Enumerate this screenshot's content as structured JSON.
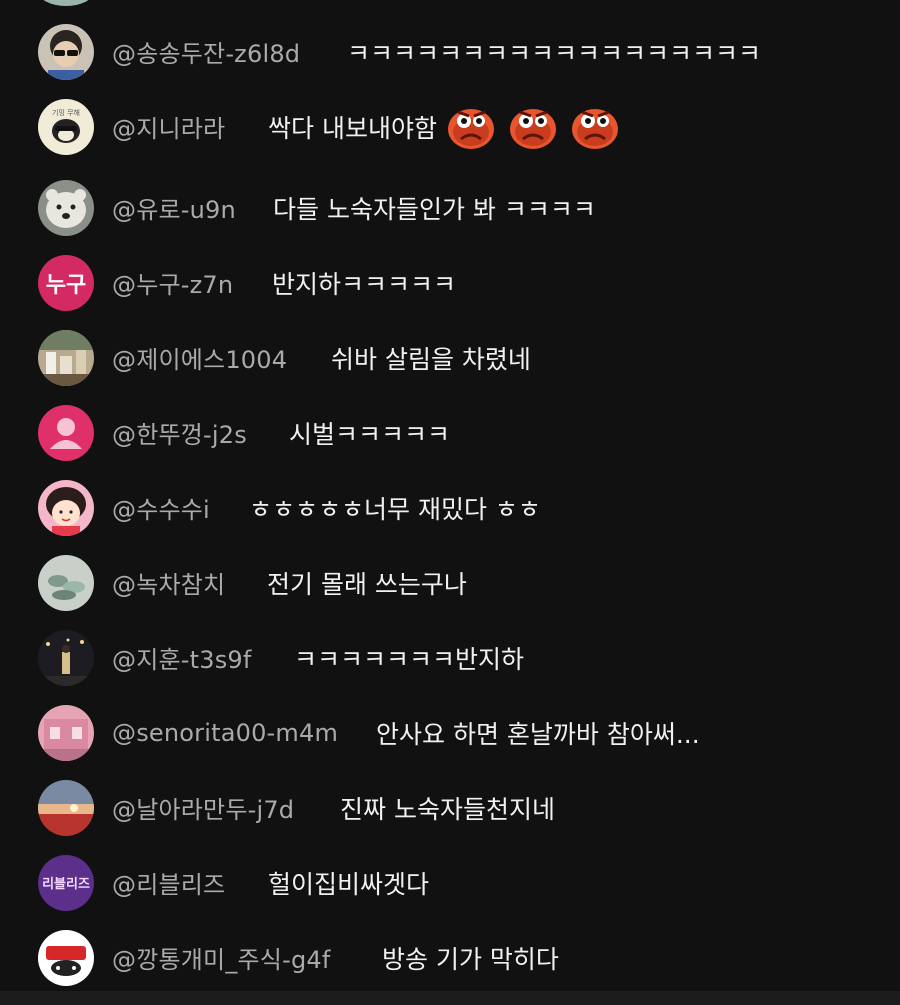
{
  "chat": {
    "messages": [
      {
        "author": "@송송두잔-z6l8d",
        "text": "ㅋㅋㅋㅋㅋㅋㅋㅋㅋㅋㅋㅋㅋㅋㅋㅋㅋㅋ",
        "avatar": "avatar-photo-person-sunglasses"
      },
      {
        "author": "@지니라라",
        "text": "싹다 내보내야함",
        "avatar": "avatar-illustration-bird",
        "emojis": [
          "angry-face-emoji",
          "angry-face-emoji",
          "angry-face-emoji"
        ]
      },
      {
        "author": "@유로-u9n",
        "text": "다들 노숙자들인가 봐 ㅋㅋㅋㅋ",
        "avatar": "avatar-photo-polar-bear"
      },
      {
        "author": "@누구-z7n",
        "text": "반지하ㅋㅋㅋㅋㅋ",
        "avatar": "avatar-text",
        "avatar_text": "누구"
      },
      {
        "author": "@제이에스1004",
        "text": "쉬바 살림을 차렸네",
        "avatar": "avatar-photo-cafe"
      },
      {
        "author": "@한뚜껑-j2s",
        "text": "시벌ㅋㅋㅋㅋㅋ",
        "avatar": "avatar-default-person"
      },
      {
        "author": "@수수수i",
        "text": "ㅎㅎㅎㅎㅎ너무 재밌다 ㅎㅎ",
        "avatar": "avatar-cartoon-girl"
      },
      {
        "author": "@녹차참치",
        "text": "전기 몰래 쓰는구나",
        "avatar": "avatar-photo-birds"
      },
      {
        "author": "@지훈-t3s9f",
        "text": "ㅋㅋㅋㅋㅋㅋㅋ반지하",
        "avatar": "avatar-photo-night-street"
      },
      {
        "author": "@senorita00-m4m",
        "text": "안사요 하면 혼날까바 참아써...",
        "avatar": "avatar-photo-pink-shop"
      },
      {
        "author": "@날아라만두-j7d",
        "text": "진짜 노숙자들천지네",
        "avatar": "avatar-photo-sunset"
      },
      {
        "author": "@리블리즈",
        "text": "헐이집비싸겟다",
        "avatar": "avatar-text-purple",
        "avatar_text": "리블리즈"
      },
      {
        "author": "@깡통개미_주식-g4f",
        "text": "방송 기가 막히다",
        "avatar": "avatar-logo-badge"
      }
    ]
  },
  "colors": {
    "background": "#111111",
    "author": "#aaaaaa",
    "message": "#f1f1f1",
    "default_avatar": "#e0306a"
  }
}
